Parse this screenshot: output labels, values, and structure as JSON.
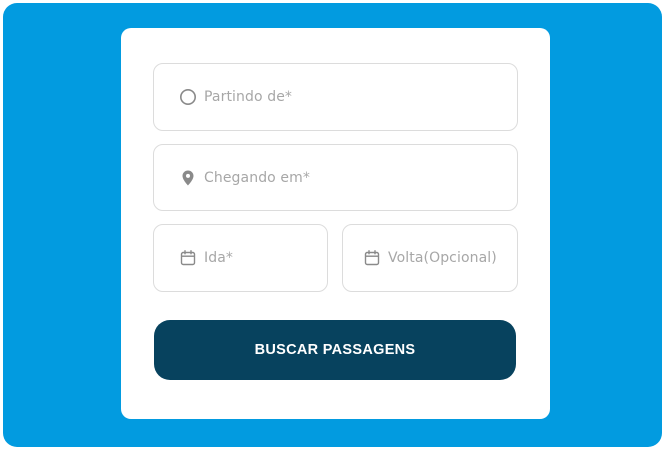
{
  "form": {
    "origin": {
      "placeholder": "Partindo de*",
      "icon": "radio-circle-icon"
    },
    "destination": {
      "placeholder": "Chegando em*",
      "icon": "location-pin-icon"
    },
    "departure_date": {
      "placeholder": "Ida*",
      "icon": "calendar-icon"
    },
    "return_date": {
      "placeholder": "Volta(Opcional)",
      "icon": "calendar-icon"
    },
    "search_button_label": "BUSCAR PASSAGENS"
  },
  "colors": {
    "background": "#029be0",
    "card": "#ffffff",
    "button": "#07425e",
    "field_border": "#dcdcdc",
    "placeholder_text": "#a7a7a7"
  }
}
